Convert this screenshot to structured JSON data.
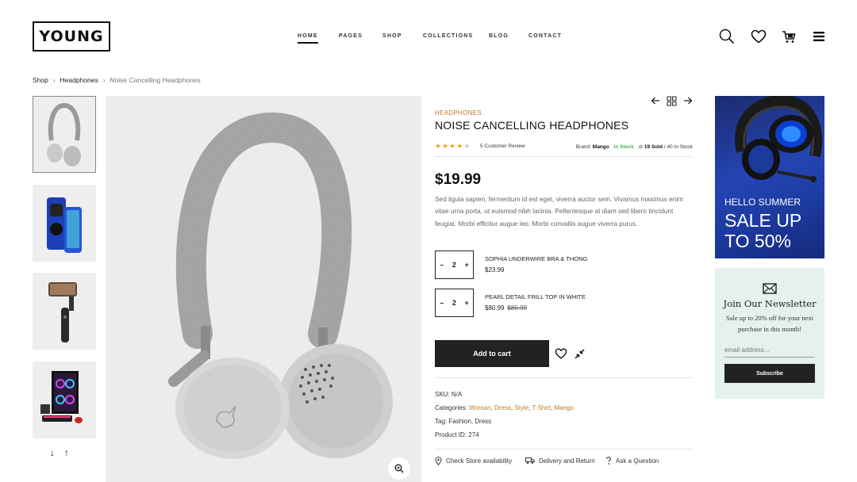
{
  "header": {
    "logo": "YOUNG",
    "nav": [
      "HOME",
      "PAGES",
      "SHOP",
      "COLLECTIONS",
      "BLOG",
      "CONTACT"
    ],
    "active_nav": "HOME",
    "cart_count": "0",
    "icons": [
      "search-icon",
      "heart-icon",
      "cart-icon",
      "menu-icon"
    ]
  },
  "breadcrumb": [
    "Shop",
    "Headphones",
    "Noise Cancelling Headphones"
  ],
  "gallery": {
    "thumbnails": [
      "headphones",
      "phone-cases",
      "phone-gimbal",
      "gaming-pc"
    ],
    "active_index": 0
  },
  "product": {
    "category": "HEADPHONES",
    "title": "NOISE CANCELLING HEADPHONES",
    "rating": 4,
    "rating_max": 5,
    "reviews": "5 Customer Review",
    "brand_label": "Brand:",
    "brand": "Mango",
    "stock_status": "In Stock",
    "sold": "19 Sold",
    "stock_total": "/ 40 In Stock",
    "price": "$19.99",
    "description": "Sed ligula sapien, fermentum id est eget, viverra auctor sem. Vivamus maximus enim vitae urna porta, ut euismod nibh lacinia. Pellentesque at diam sed libero tincidunt feugiat. Morbi efficitur augue leo. Morbi convallis augue viverra purus.",
    "bundle": [
      {
        "qty": "2",
        "name": "SOPHIA UNDERWIRE BRA & THONG",
        "price": "$23.99",
        "old_price": ""
      },
      {
        "qty": "2",
        "name": "PEARL DETAIL FRILL TOP IN WHITE",
        "price": "$80.99",
        "old_price": "$80.99"
      }
    ],
    "add_to_cart": "Add to cart",
    "sku_label": "SKU:",
    "sku": "N/A",
    "categories_label": "Categories:",
    "categories": [
      "Woman",
      "Dress",
      "Style",
      "T-Shirt",
      "Mango"
    ],
    "tag_label": "Tag:",
    "tags": "Fashion, Dress",
    "product_id_label": "Product ID:",
    "product_id": "274",
    "links": [
      "Check Store availability",
      "Delivery and Return",
      "Ask a Question"
    ]
  },
  "banner": {
    "line1": "HELLO SUMMER",
    "line2": "SALE UP",
    "line3": "TO 50%"
  },
  "newsletter": {
    "title": "Join Our Newsletter",
    "text": "Sale up to 20% off for your next purchase in this month!",
    "placeholder": "email address...",
    "button": "Subscribe"
  },
  "colors": {
    "accent": "#c07a22",
    "in_stock": "#4caf50",
    "star": "#f0a820",
    "dark": "#222222",
    "newsletter_bg": "#e4f1ec"
  }
}
